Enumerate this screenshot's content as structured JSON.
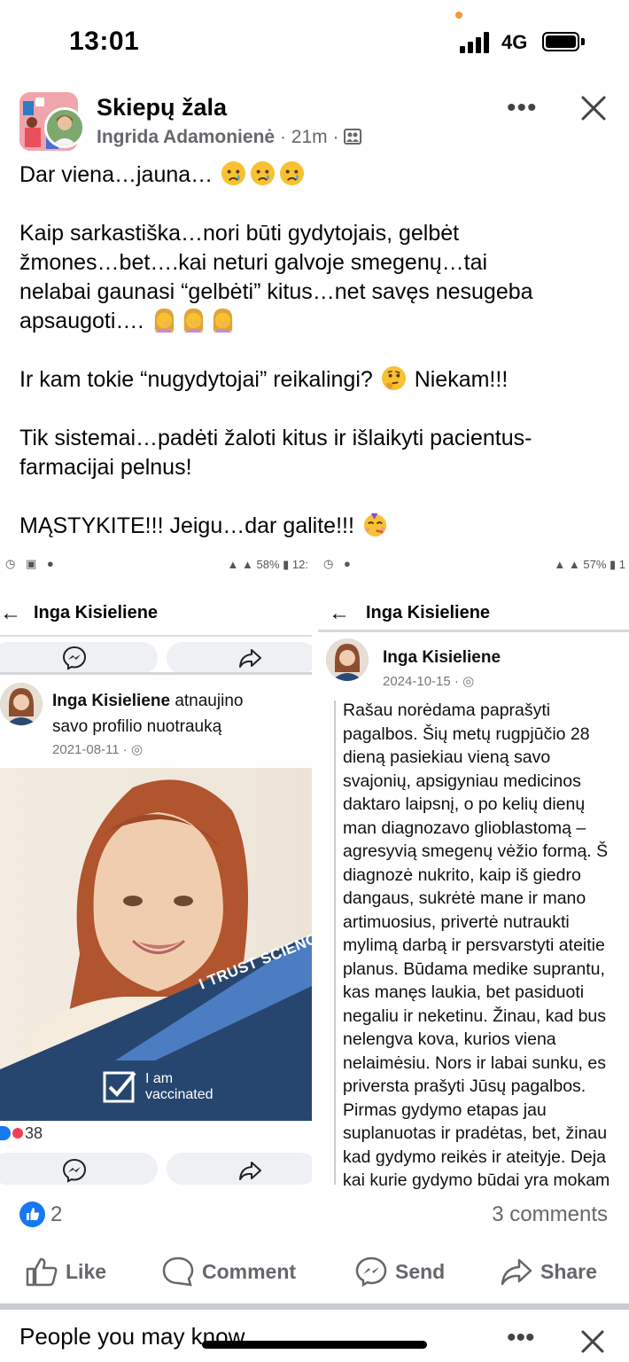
{
  "status_bar": {
    "time": "13:01",
    "network": "4G"
  },
  "post": {
    "group_name": "Skiepų žala",
    "author": "Ingrida Adamonienė",
    "time_ago": "21m",
    "meta_separator": "·",
    "text": {
      "line1": "Dar viena…jauna…",
      "para2_line1": "Kaip sarkastiška…nori būti gydytojais, gelbėt",
      "para2_line2": "žmones…bet….kai neturi galvoje smegenų…tai",
      "para2_line3": "nelabai gaunasi “gelbėti” kitus…net savęs nesugeba",
      "para2_line4": "apsaugoti….",
      "para3_a": "Ir kam tokie “nugydytojai” reikalingi?",
      "para3_b": "Niekam!!!",
      "para4_line1": "Tik sistemai…padėti žaloti kitus ir išlaikyti pacientus-",
      "para4_line2": "farmacijai pelnus!",
      "para5": "MĄSTYKITE!!! Jeigu…dar galite!!!"
    },
    "emojis": [
      "crying-face",
      "face-palm",
      "thinking-face",
      "partying-face"
    ]
  },
  "left_screenshot": {
    "status_battery": "58%",
    "status_clock": "12:",
    "profile_name": "Inga Kisieliene",
    "update_name": "Inga Kisieliene",
    "update_text_1": "atnaujino",
    "update_text_2": "savo profilio nuotrauką",
    "date": "2021-08-11",
    "photo_banner": "I TRUST SCIENC",
    "badge_line1": "I am",
    "badge_line2": "vaccinated",
    "reaction_count": "38"
  },
  "right_screenshot": {
    "status_battery": "57%",
    "profile_name": "Inga Kisieliene",
    "post_name": "Inga Kisieliene",
    "date": "2024-10-15",
    "lines": [
      "Rašau norėdama paprašyti",
      "pagalbos. Šių metų rugpjūčio 28",
      "dieną pasiekiau vieną savo",
      "svajonių, apsigyniau medicinos",
      "daktaro laipsnį, o po kelių dienų",
      "man diagnozavo glioblastomą –",
      "agresyvią smegenų vėžio formą. Š",
      "diagnozė nukrito, kaip iš giedro",
      "dangaus, sukrėtė mane ir mano",
      "artimuosius, privertė nutraukti",
      "mylimą darbą ir persvarstyti ateitie",
      "planus. Būdama medike suprantu,",
      "kas manęs laukia, bet pasiduoti",
      "negaliu ir neketinu. Žinau, kad bus",
      "nelengva kova, kurios viena",
      "nelaimėsiu. Nors ir labai sunku, es",
      "priversta prašyti Jūsų pagalbos.",
      "Pirmas gydymo etapas jau",
      "suplanuotas ir pradėtas, bet, žinau",
      "kad gydymo reikės ir ateityje. Deja",
      "kai kurie gydymo būdai yra mokam"
    ]
  },
  "engagement": {
    "likes": "2",
    "comments": "3 comments",
    "actions": {
      "like": "Like",
      "comment": "Comment",
      "send": "Send",
      "share": "Share"
    }
  },
  "people_you_may_know": {
    "title": "People you may know"
  },
  "colors": {
    "facebook_blue": "#1877f2",
    "meta_gray": "#65676b",
    "vaccine_navy": "#27466f",
    "vaccine_banner": "#3e6db0"
  }
}
